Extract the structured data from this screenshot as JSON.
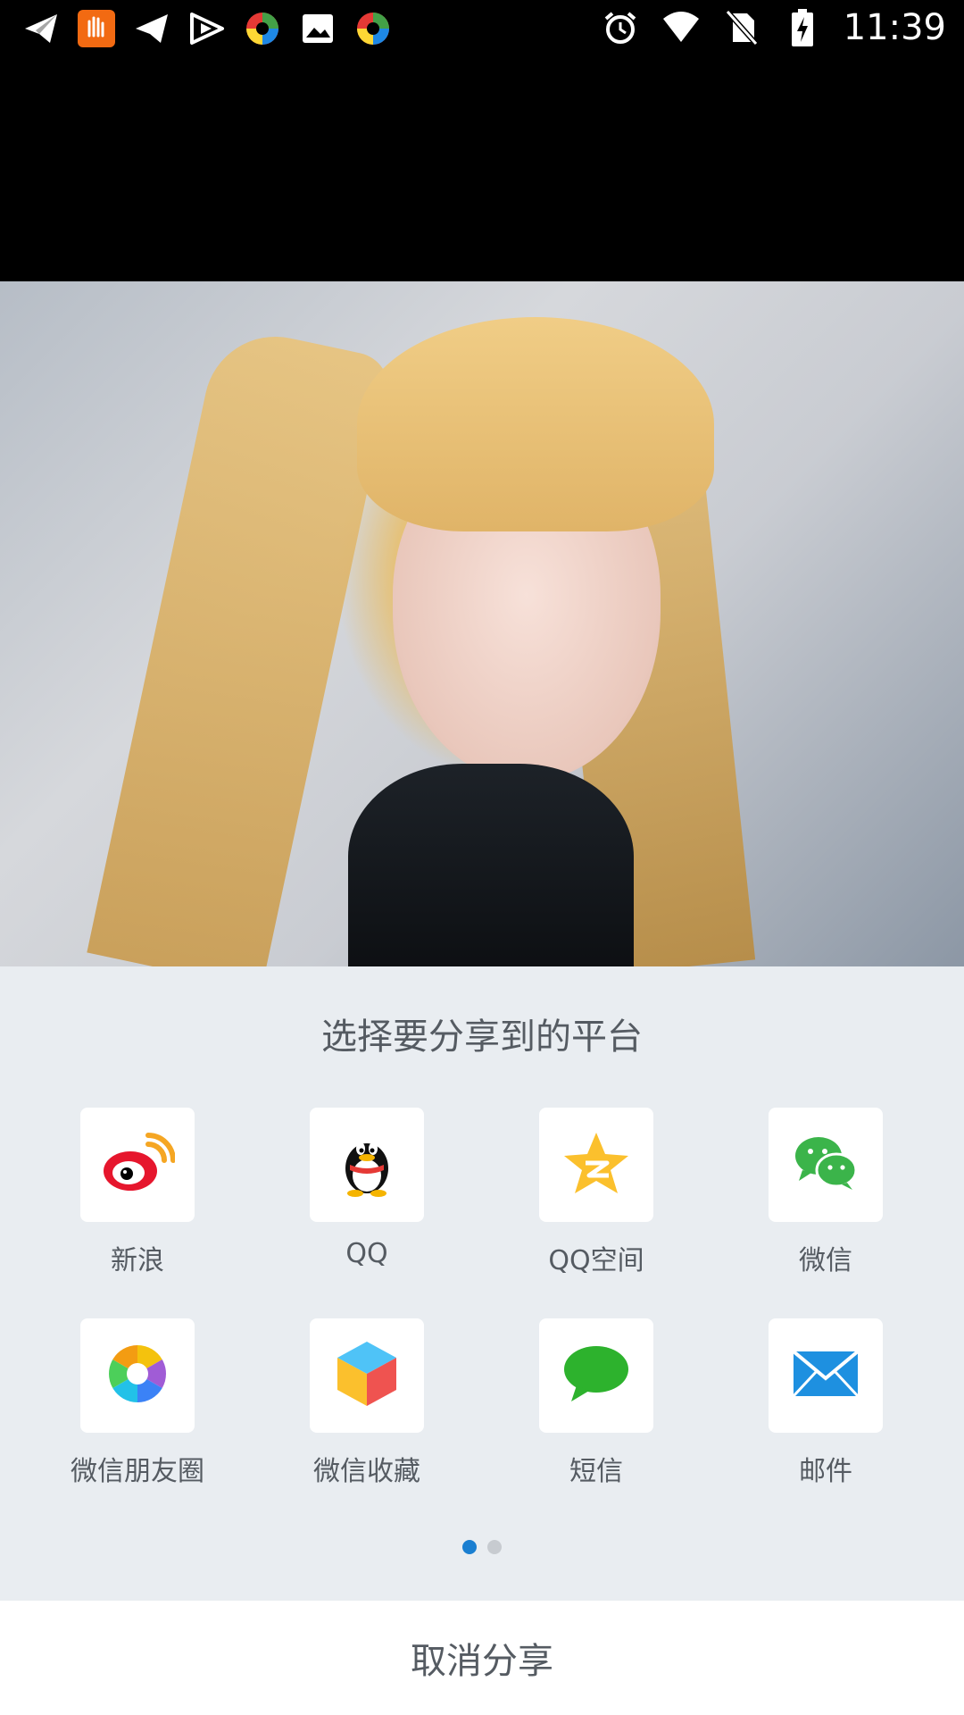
{
  "status_bar": {
    "time": "11:39",
    "left_icons": [
      "telegram-icon",
      "app-51job-icon",
      "telegram-icon",
      "video-play-icon",
      "colorful-app-icon",
      "gallery-icon",
      "colorful-app-icon"
    ],
    "right_icons": [
      "alarm-icon",
      "wifi-icon",
      "no-sim-icon",
      "battery-charging-icon"
    ]
  },
  "share_sheet": {
    "title": "选择要分享到的平台",
    "platforms": [
      {
        "label": "新浪",
        "icon": "weibo-icon"
      },
      {
        "label": "QQ",
        "icon": "qq-icon"
      },
      {
        "label": "QQ空间",
        "icon": "qzone-icon"
      },
      {
        "label": "微信",
        "icon": "wechat-icon"
      },
      {
        "label": "微信朋友圈",
        "icon": "wechat-moments-icon"
      },
      {
        "label": "微信收藏",
        "icon": "wechat-favorites-icon"
      },
      {
        "label": "短信",
        "icon": "sms-icon"
      },
      {
        "label": "邮件",
        "icon": "email-icon"
      }
    ],
    "page_indicator": {
      "pages": 2,
      "active": 1,
      "active_color": "#1a7fd1",
      "inactive_color": "#c7cbd0"
    },
    "cancel_label": "取消分享"
  }
}
